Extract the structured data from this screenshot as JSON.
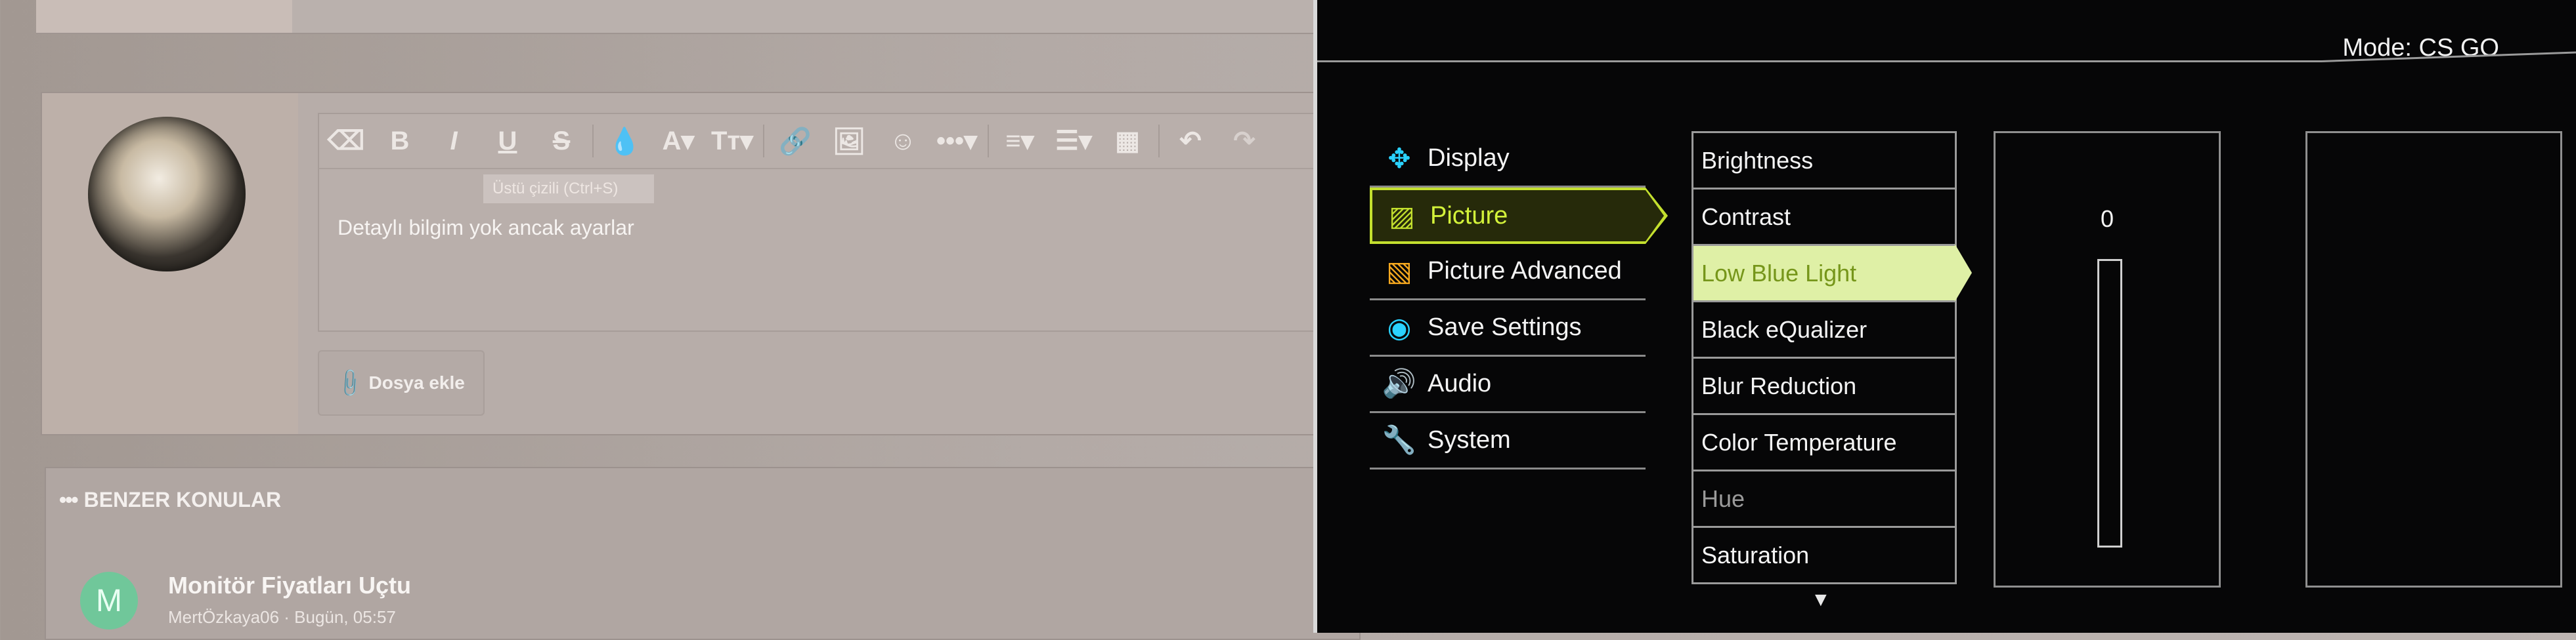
{
  "editor": {
    "toolbar": [
      {
        "name": "eraser-icon",
        "glyph": "⌫"
      },
      {
        "name": "bold-button",
        "glyph": "B"
      },
      {
        "name": "italic-button",
        "glyph": "I"
      },
      {
        "name": "underline-button",
        "glyph": "U"
      },
      {
        "name": "strikethrough-button",
        "glyph": "S"
      },
      {
        "name": "color-drop-icon",
        "glyph": "💧"
      },
      {
        "name": "font-color-button",
        "glyph": "A▾"
      },
      {
        "name": "font-size-button",
        "glyph": "Tт▾"
      },
      {
        "name": "link-icon",
        "glyph": "🔗"
      },
      {
        "name": "image-icon",
        "glyph": "🖼"
      },
      {
        "name": "emoji-icon",
        "glyph": "☺"
      },
      {
        "name": "more-icon",
        "glyph": "•••▾"
      },
      {
        "name": "align-icon",
        "glyph": "≡▾"
      },
      {
        "name": "list-icon",
        "glyph": "☰▾"
      },
      {
        "name": "table-icon",
        "glyph": "▦"
      },
      {
        "name": "undo-icon",
        "glyph": "↶"
      },
      {
        "name": "redo-icon",
        "glyph": "↷"
      }
    ],
    "tooltip": "Üstü çizili (Ctrl+S)",
    "content": "Detaylı bilgim yok ancak ayarlar"
  },
  "attach_button": {
    "icon": "📎",
    "label": "Dosya ekle"
  },
  "similar": {
    "title": "BENZER KONULAR",
    "threads": [
      {
        "avatar_letter": "M",
        "title": "Monitör Fiyatları Uçtu",
        "meta": "MertÖzkaya06 · Bugün, 05:57"
      }
    ]
  },
  "osd": {
    "mode": "Mode: CS GO",
    "menu": [
      {
        "label": "Display",
        "icon": "display-icon",
        "glyph": "✥",
        "cls": "i-display"
      },
      {
        "label": "Picture",
        "icon": "picture-icon",
        "glyph": "▨",
        "cls": "i-picture",
        "active": true
      },
      {
        "label": "Picture Advanced",
        "icon": "picture-advanced-icon",
        "glyph": "▧",
        "cls": "i-adv"
      },
      {
        "label": "Save Settings",
        "icon": "save-settings-icon",
        "glyph": "◉",
        "cls": "i-save"
      },
      {
        "label": "Audio",
        "icon": "audio-icon",
        "glyph": "🔊",
        "cls": "i-audio"
      },
      {
        "label": "System",
        "icon": "wrench-icon",
        "glyph": "🔧",
        "cls": "i-system"
      }
    ],
    "submenu": [
      {
        "label": "Brightness"
      },
      {
        "label": "Contrast"
      },
      {
        "label": "Low Blue Light",
        "active": true
      },
      {
        "label": "Black eQualizer"
      },
      {
        "label": "Blur Reduction"
      },
      {
        "label": "Color Temperature"
      },
      {
        "label": "Hue",
        "dim": true
      },
      {
        "label": "Saturation"
      }
    ],
    "value": "0",
    "value_fraction": 0,
    "scroll_glyph": "▼"
  }
}
